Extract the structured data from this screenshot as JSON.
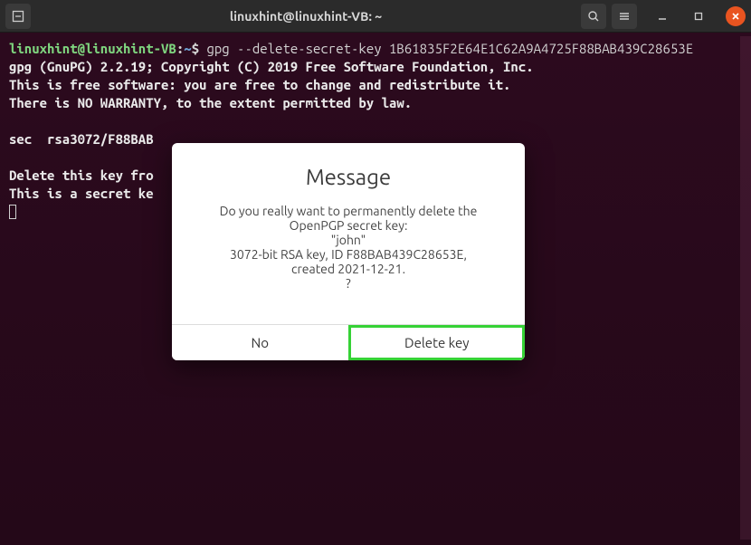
{
  "titlebar": {
    "title": "linuxhint@linuxhint-VB: ~"
  },
  "terminal": {
    "prompt_user": "linuxhint@linuxhint-VB",
    "prompt_sep": ":",
    "prompt_path": "~",
    "prompt_dollar": "$ ",
    "command": "gpg --delete-secret-key 1B61835F2E64E1C62A9A4725F88BAB439C28653E",
    "gpg_version": "gpg (GnuPG) 2.2.19; Copyright (C) 2019 Free Software Foundation, Inc.",
    "line_free": "This is free software: you are free to change and redistribute it.",
    "line_warranty": "There is NO WARRANTY, to the extent permitted by law.",
    "sec_line": "sec  rsa3072/F88BAB",
    "delete_line": "Delete this key fro",
    "secret_line": "This is a secret ke"
  },
  "dialog": {
    "title": "Message",
    "line1": "Do you really want to permanently delete the",
    "line2": "OpenPGP secret key:",
    "line3": "\"john\"",
    "line4": "3072-bit RSA key, ID F88BAB439C28653E,",
    "line5": "created 2021-12-21.",
    "line6": "?",
    "no_label": "No",
    "delete_label": "Delete key"
  }
}
